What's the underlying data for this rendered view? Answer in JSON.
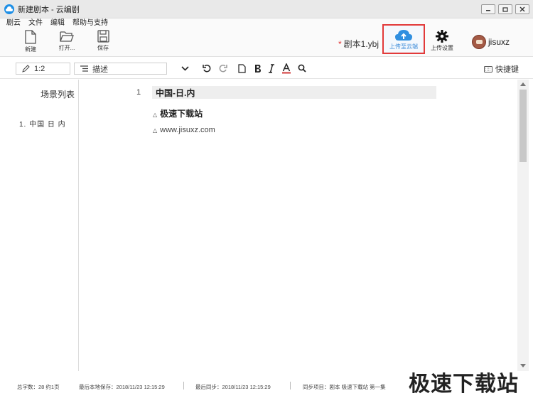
{
  "window": {
    "title": "新建剧本 - 云编剧"
  },
  "menu": [
    "剧云",
    "文件",
    "编辑",
    "帮助与支持"
  ],
  "toolbar": {
    "new_label": "新建",
    "open_label": "打开...",
    "save_label": "保存",
    "doc_name": "剧本1.ybj",
    "doc_modified_marker": "*",
    "upload_cloud_label": "上传至云端",
    "upload_settings_label": "上传设置",
    "username": "jisuxz"
  },
  "format": {
    "position": "1:2",
    "element_type": "描述",
    "shortcut_label": "快捷键"
  },
  "scenes": {
    "title": "场景列表",
    "items": [
      "1. 中国 日 内"
    ]
  },
  "editor": {
    "line_number": "1",
    "scene_heading": "中国-日.内",
    "action_lines": [
      "极速下载站",
      "www.jisuxz.com"
    ]
  },
  "status": {
    "word_count": "总字数：28 约1页",
    "last_saved": "最后本地保存：2018/11/23 12:15:29",
    "last_sync": "最后同步：2018/11/23 12:15:29",
    "sync_project": "同步项目：剧本 极速下载站 第一集"
  },
  "watermark": "极速下载站",
  "colors": {
    "accent": "#1e8fe6",
    "highlight": "#e23a3a"
  }
}
